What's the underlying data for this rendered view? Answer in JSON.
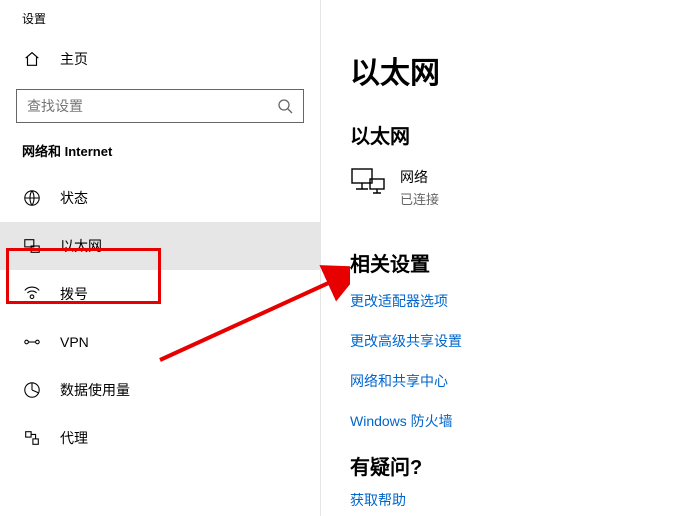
{
  "window_title": "设置",
  "home_label": "主页",
  "search": {
    "placeholder": "查找设置"
  },
  "category": "网络和 Internet",
  "nav": [
    {
      "label": "状态"
    },
    {
      "label": "以太网"
    },
    {
      "label": "拨号"
    },
    {
      "label": "VPN"
    },
    {
      "label": "数据使用量"
    },
    {
      "label": "代理"
    }
  ],
  "main": {
    "title": "以太网",
    "subtitle": "以太网",
    "network": {
      "name": "网络",
      "status": "已连接"
    },
    "related_title": "相关设置",
    "links": [
      "更改适配器选项",
      "更改高级共享设置",
      "网络和共享中心",
      "Windows 防火墙"
    ],
    "question_title": "有疑问?",
    "help_link": "获取帮助"
  }
}
